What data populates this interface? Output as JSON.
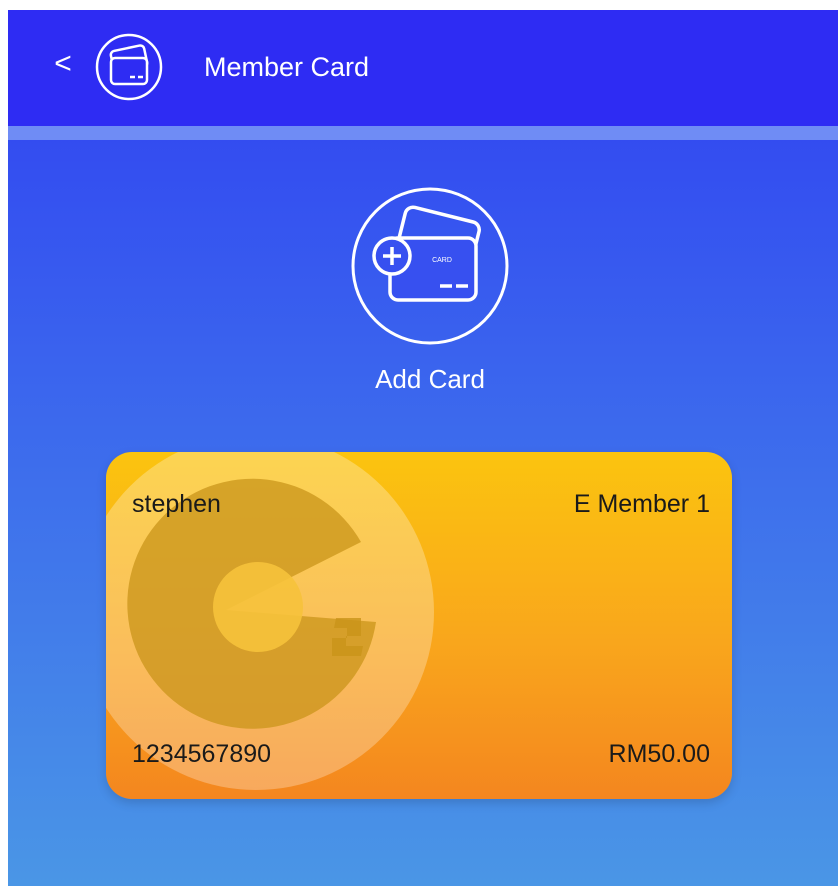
{
  "header": {
    "back_label": "<",
    "icon": "member-card-icon",
    "title": "Member Card"
  },
  "add_card": {
    "icon": "add-card-icon",
    "label": "Add Card",
    "icon_card_text": "CARD"
  },
  "member_card": {
    "name": "stephen",
    "tier": "E Member 1",
    "number": "1234567890",
    "balance": "RM50.00",
    "logo": "e2-logo"
  },
  "colors": {
    "header_bg": "#2e2cf3",
    "header_strip": "#6f8cf5",
    "bg_top": "#2f3ff2",
    "bg_bottom": "#4a96e6",
    "card_top": "#fbc40f",
    "card_bottom": "#f4861f"
  }
}
